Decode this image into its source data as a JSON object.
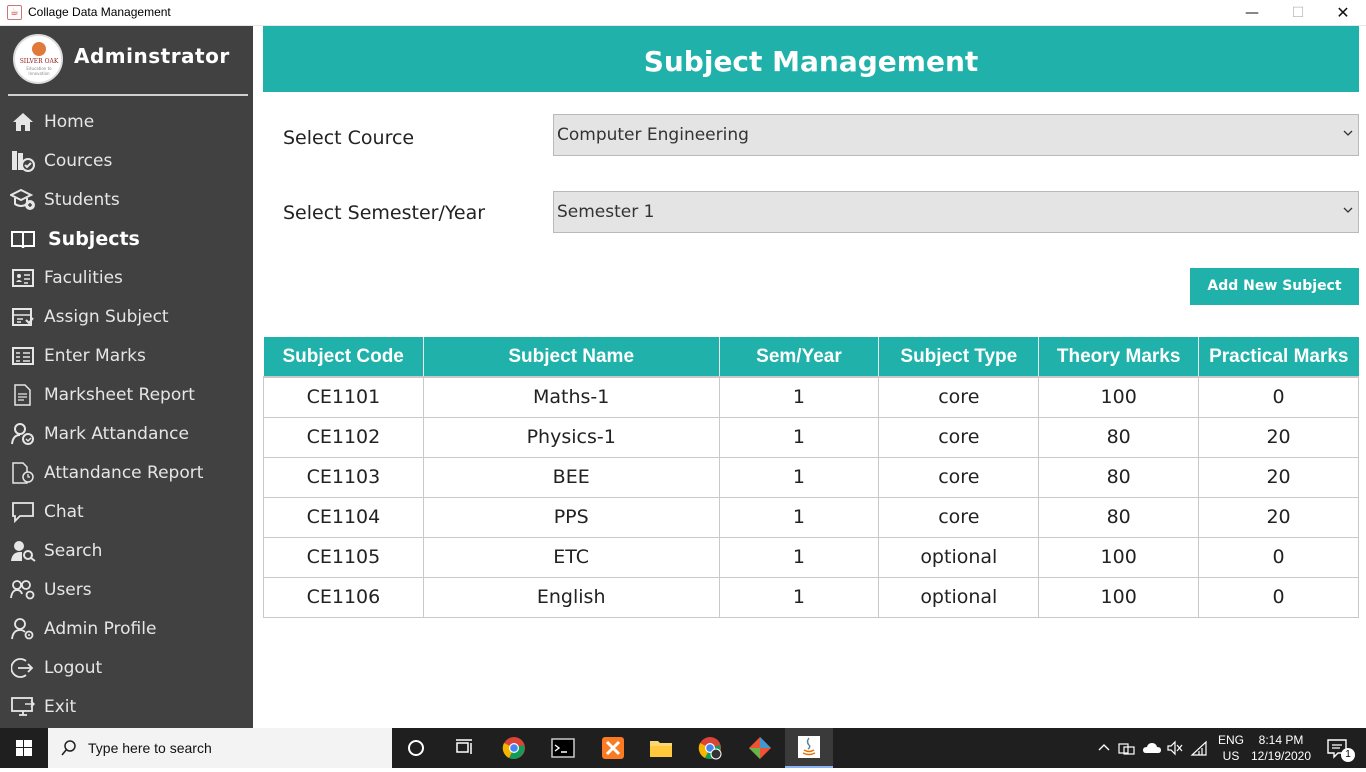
{
  "window": {
    "title": "Collage Data Management"
  },
  "sidebar": {
    "admin_title": "Adminstrator",
    "logo_text": "SILVER OAK",
    "logo_sub": "Education to Innovation",
    "items": [
      {
        "label": "Home",
        "icon": "home-icon"
      },
      {
        "label": "Cources",
        "icon": "courses-icon"
      },
      {
        "label": "Students",
        "icon": "students-icon"
      },
      {
        "label": "Subjects",
        "icon": "book-icon",
        "active": true
      },
      {
        "label": "Faculities",
        "icon": "faculty-icon"
      },
      {
        "label": "Assign Subject",
        "icon": "assign-icon"
      },
      {
        "label": "Enter Marks",
        "icon": "marks-icon"
      },
      {
        "label": "Marksheet Report",
        "icon": "report-icon"
      },
      {
        "label": "Mark Attandance",
        "icon": "attendance-icon"
      },
      {
        "label": "Attandance Report",
        "icon": "attendance-report-icon"
      },
      {
        "label": "Chat",
        "icon": "chat-icon"
      },
      {
        "label": "Search",
        "icon": "search-user-icon"
      },
      {
        "label": "Users",
        "icon": "users-icon"
      },
      {
        "label": "Admin Profile",
        "icon": "admin-profile-icon"
      },
      {
        "label": "Logout",
        "icon": "logout-icon"
      },
      {
        "label": "Exit",
        "icon": "exit-icon"
      }
    ]
  },
  "main": {
    "title": "Subject Management",
    "course_label": "Select Cource",
    "course_value": "Computer Engineering",
    "semester_label": "Select Semester/Year",
    "semester_value": "Semester 1",
    "add_button": "Add New Subject"
  },
  "table": {
    "headers": [
      "Subject Code",
      "Subject Name",
      "Sem/Year",
      "Subject Type",
      "Theory Marks",
      "Practical Marks"
    ],
    "rows": [
      [
        "CE1101",
        "Maths-1",
        "1",
        "core",
        "100",
        "0"
      ],
      [
        "CE1102",
        "Physics-1",
        "1",
        "core",
        "80",
        "20"
      ],
      [
        "CE1103",
        "BEE",
        "1",
        "core",
        "80",
        "20"
      ],
      [
        "CE1104",
        "PPS",
        "1",
        "core",
        "80",
        "20"
      ],
      [
        "CE1105",
        "ETC",
        "1",
        "optional",
        "100",
        "0"
      ],
      [
        "CE1106",
        "English",
        "1",
        "optional",
        "100",
        "0"
      ]
    ]
  },
  "taskbar": {
    "search_placeholder": "Type here to search",
    "lang_top": "ENG",
    "lang_bottom": "US",
    "time": "8:14 PM",
    "date": "12/19/2020",
    "notification_count": "1"
  },
  "colors": {
    "accent": "#20b2aa",
    "sidebar": "#414141"
  }
}
